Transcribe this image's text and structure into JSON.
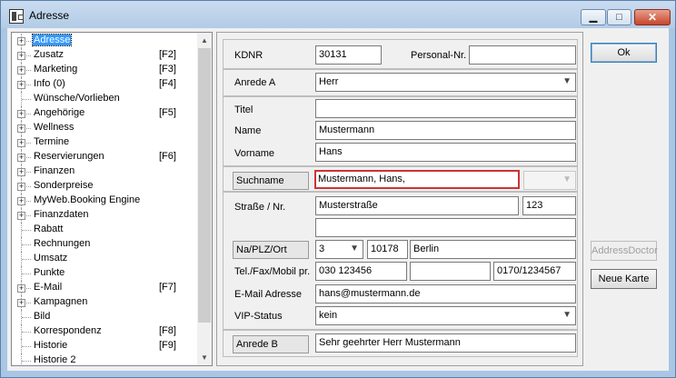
{
  "window": {
    "title": "Adresse"
  },
  "tree": {
    "items": [
      {
        "label": "Adresse",
        "key": "",
        "expandable": true,
        "selected": true
      },
      {
        "label": "Zusatz",
        "key": "[F2]",
        "expandable": true
      },
      {
        "label": "Marketing",
        "key": "[F3]",
        "expandable": true
      },
      {
        "label": "Info (0)",
        "key": "[F4]",
        "expandable": true
      },
      {
        "label": "Wünsche/Vorlieben",
        "key": "",
        "expandable": false
      },
      {
        "label": "Angehörige",
        "key": "[F5]",
        "expandable": true
      },
      {
        "label": "Wellness",
        "key": "",
        "expandable": true
      },
      {
        "label": "Termine",
        "key": "",
        "expandable": true
      },
      {
        "label": "Reservierungen",
        "key": "[F6]",
        "expandable": true
      },
      {
        "label": "Finanzen",
        "key": "",
        "expandable": true
      },
      {
        "label": "Sonderpreise",
        "key": "",
        "expandable": true
      },
      {
        "label": "MyWeb.Booking Engine",
        "key": "",
        "expandable": true
      },
      {
        "label": "Finanzdaten",
        "key": "",
        "expandable": true
      },
      {
        "label": "Rabatt",
        "key": "",
        "expandable": false
      },
      {
        "label": "Rechnungen",
        "key": "",
        "expandable": false
      },
      {
        "label": "Umsatz",
        "key": "",
        "expandable": false
      },
      {
        "label": "Punkte",
        "key": "",
        "expandable": false
      },
      {
        "label": "E-Mail",
        "key": "[F7]",
        "expandable": true
      },
      {
        "label": "Kampagnen",
        "key": "",
        "expandable": true
      },
      {
        "label": "Bild",
        "key": "",
        "expandable": false
      },
      {
        "label": "Korrespondenz",
        "key": "[F8]",
        "expandable": false
      },
      {
        "label": "Historie",
        "key": "[F9]",
        "expandable": false
      },
      {
        "label": "Historie 2",
        "key": "",
        "expandable": false
      }
    ]
  },
  "form": {
    "kdnr_label": "KDNR",
    "kdnr_value": "30131",
    "personal_label": "Personal-Nr.",
    "personal_value": "",
    "anrede_a_label": "Anrede A",
    "anrede_a_value": "Herr",
    "titel_label": "Titel",
    "titel_value": "",
    "name_label": "Name",
    "name_value": "Mustermann",
    "vorname_label": "Vorname",
    "vorname_value": "Hans",
    "suchname_label": "Suchname",
    "suchname_value": "Mustermann, Hans,",
    "strasse_label": "Straße / Nr.",
    "strasse_value": "Musterstraße",
    "hausnr_value": "123",
    "adresszusatz_value": "",
    "ort_label": "Na/PLZ/Ort",
    "nation_value": "3",
    "plz_value": "10178",
    "ort_value": "Berlin",
    "tel_label": "Tel./Fax/Mobil pr.",
    "tel_value": "030 123456",
    "fax_value": "",
    "mobil_value": "0170/1234567",
    "email_label": "E-Mail Adresse",
    "email_value": "hans@mustermann.de",
    "vip_label": "VIP-Status",
    "vip_value": "kein",
    "anrede_b_label": "Anrede B",
    "anrede_b_value": "Sehr geehrter Herr Mustermann"
  },
  "buttons": {
    "ok": "Ok",
    "address_doctor": "AddressDoctor",
    "neue_karte": "Neue Karte"
  },
  "icons": {
    "dropdown": "▼",
    "expand": "+",
    "scroll_up": "▲",
    "scroll_down": "▼",
    "minimize": "▁",
    "maximize": "□",
    "close": "✕"
  }
}
